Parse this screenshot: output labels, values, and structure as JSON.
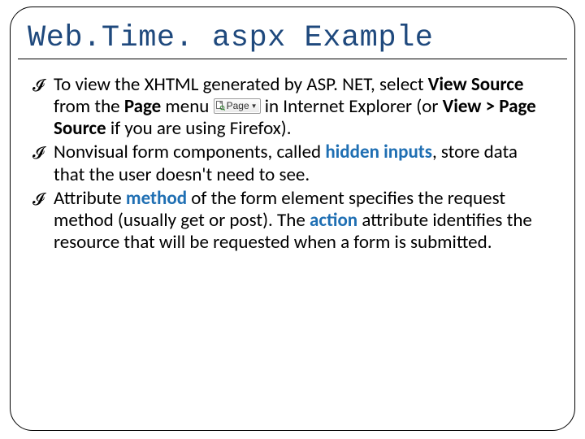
{
  "title": "Web.Time. aspx Example",
  "items": [
    {
      "pre": "To view the XHTML generated by ASP. NET, select ",
      "b1": "View Source",
      "mid1": " from the ",
      "b2": "Page",
      "mid2": " menu ",
      "pageBtn": {
        "label": "Page"
      },
      "mid3": "  in  Internet Explorer (or ",
      "b3": "View > Page Source",
      "post": " if you are using Firefox)."
    },
    {
      "pre": "Nonvisual form components, called ",
      "kw": "hidden inputs",
      "post": ", store data that the user doesn't need to see."
    },
    {
      "pre": "Attribute ",
      "kw1": "method",
      "mid": " of the form element specifies the request method (usually get or post). The ",
      "kw2": "action",
      "post": " attribute identifies the resource that will be requested when a form is submitted."
    }
  ]
}
